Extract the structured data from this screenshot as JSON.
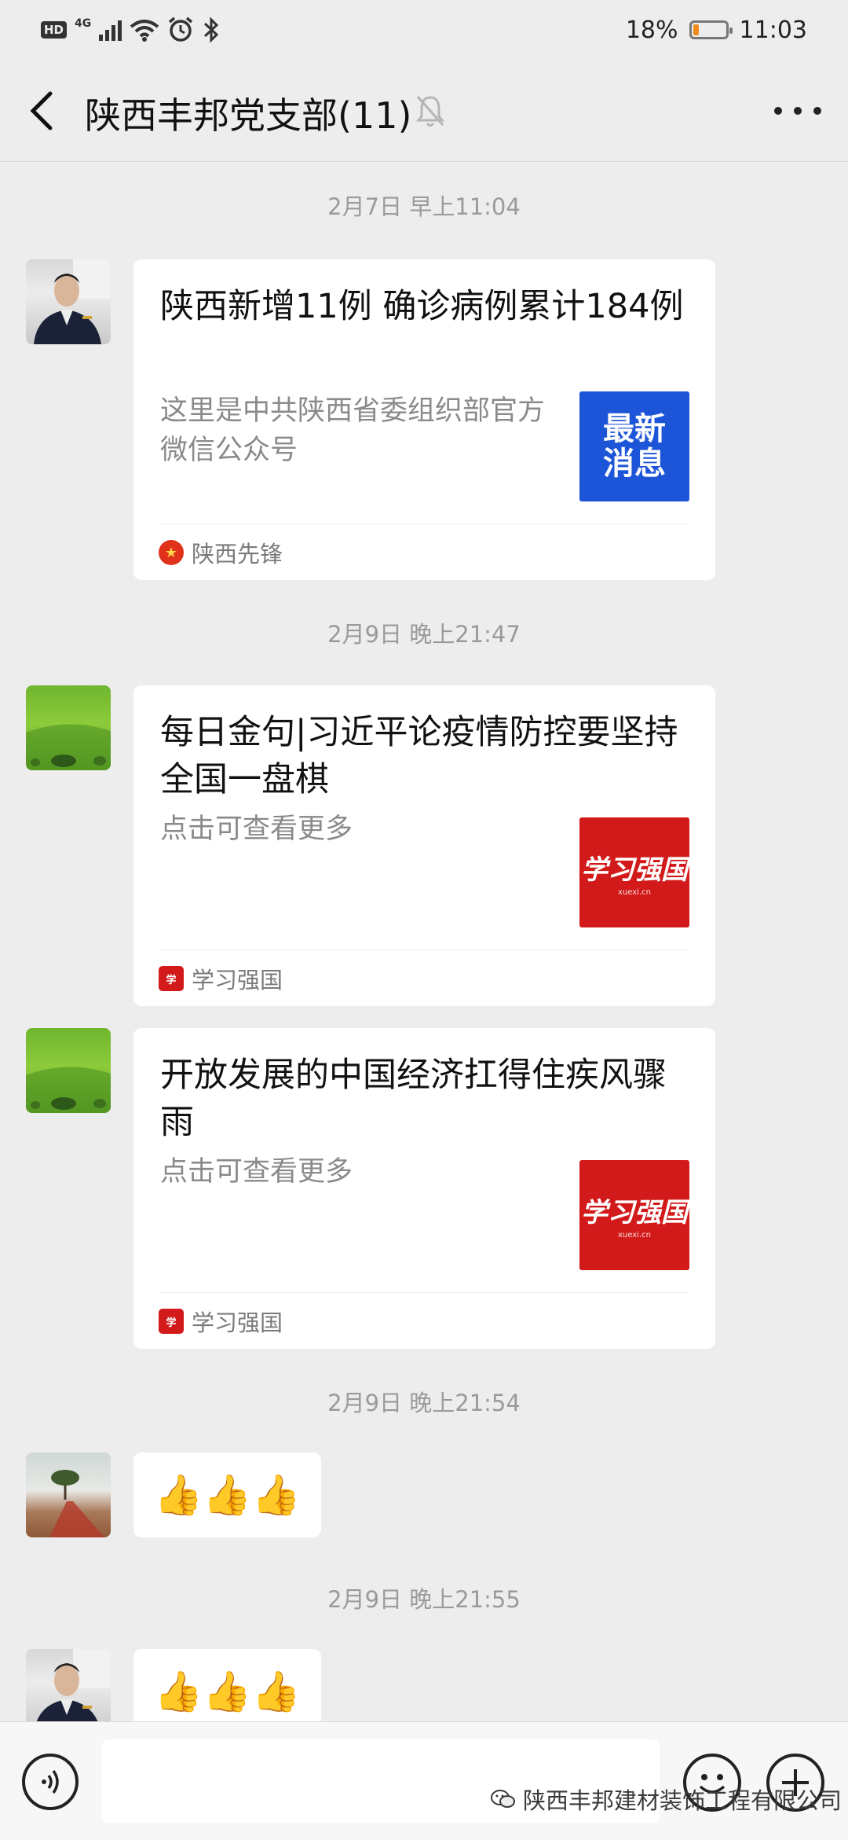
{
  "status_bar": {
    "hd": "HD",
    "network": "4G",
    "battery_text": "18%",
    "battery_level": 0.18,
    "time": "11:03",
    "icons": [
      "hd-icon",
      "signal-icon",
      "wifi-icon",
      "alarm-icon",
      "bluetooth-icon",
      "battery-icon"
    ]
  },
  "header": {
    "title": "陕西丰邦党支部(11)",
    "icons": [
      "back-arrow-icon",
      "mute-bell-icon",
      "more-dots-icon"
    ]
  },
  "messages": [
    {
      "time": "2月7日 早上11:04",
      "card": {
        "title": "陕西新增11例 确诊病例累计184例",
        "desc": "这里是中共陕西省委组织部官方微信公众号",
        "thumb_text": "最新消息",
        "source": "陕西先锋"
      }
    },
    {
      "time": "2月9日 晚上21:47",
      "card": {
        "title": "每日金句|习近平论疫情防控要坚持全国一盘棋",
        "desc": "点击可查看更多",
        "thumb_text": "学习强国",
        "thumb_sub": "xuexi.cn",
        "source": "学习强国"
      }
    },
    {
      "card": {
        "title": "开放发展的中国经济扛得住疾风骤雨",
        "desc": "点击可查看更多",
        "thumb_text": "学习强国",
        "thumb_sub": "xuexi.cn",
        "source": "学习强国"
      }
    },
    {
      "time": "2月9日 晚上21:54",
      "emoji": "👍👍👍"
    },
    {
      "time": "2月9日 晚上21:55",
      "emoji": "👍👍👍"
    }
  ],
  "input_bar": {
    "icons": [
      "voice-icon",
      "emoji-icon",
      "plus-icon"
    ]
  },
  "watermark": "陕西丰邦建材装饰工程有限公司"
}
